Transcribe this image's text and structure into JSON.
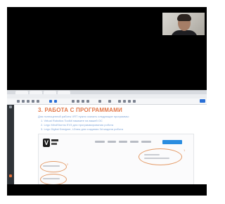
{
  "browser": {
    "tabs": [
      "",
      "",
      "",
      ""
    ],
    "menu": [
      "",
      "",
      "",
      ""
    ]
  },
  "slide": {
    "title": "3. РАБОТА С ПРОГРАММАМИ",
    "intro": "Для полноценной работы VRT нужно скачать следующие программы:",
    "items": [
      "1.  Virtual Robotics Toolkit нажмите на вашей ОС",
      "2.  Lego MindStorms EV3 для программирования робота",
      "3.  Lego Digital Designer, LDraw для создания 3d модели робота"
    ],
    "annotations": [
      "1",
      "2"
    ]
  },
  "colors": {
    "title": "#e3794a",
    "body_text": "#7da4d8",
    "annotation": "#e49a66",
    "cta": "#2a8de0",
    "frame_bg": "#000000"
  }
}
